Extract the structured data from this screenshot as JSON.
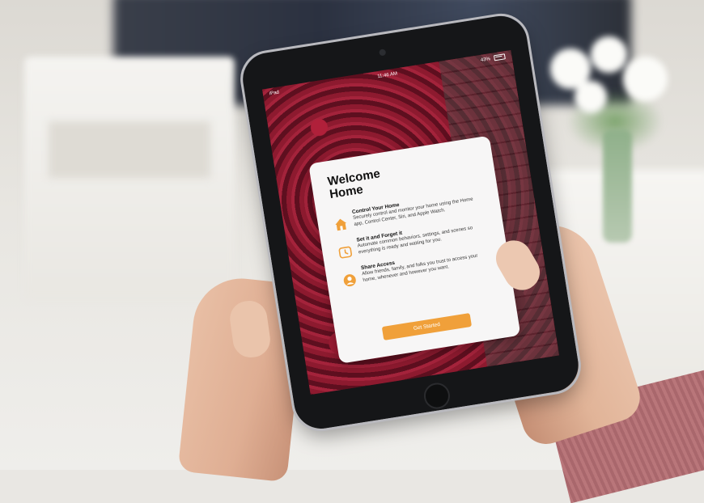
{
  "status_bar": {
    "carrier": "iPad",
    "time": "11:46 AM",
    "battery": "43%"
  },
  "welcome_card": {
    "title": "Welcome Home",
    "features": [
      {
        "icon": "house-icon",
        "title": "Control Your Home",
        "description": "Securely control and monitor your home using the Home app, Control Center, Siri, and Apple Watch."
      },
      {
        "icon": "clock-icon",
        "title": "Set it and Forget it",
        "description": "Automate common behaviors, settings, and scenes so everything is ready and waiting for you."
      },
      {
        "icon": "person-icon",
        "title": "Share Access",
        "description": "Allow friends, family, and folks you trust to access your home, whenever and however you want."
      }
    ],
    "button_label": "Get Started",
    "accent_color": "#f0a03a"
  }
}
